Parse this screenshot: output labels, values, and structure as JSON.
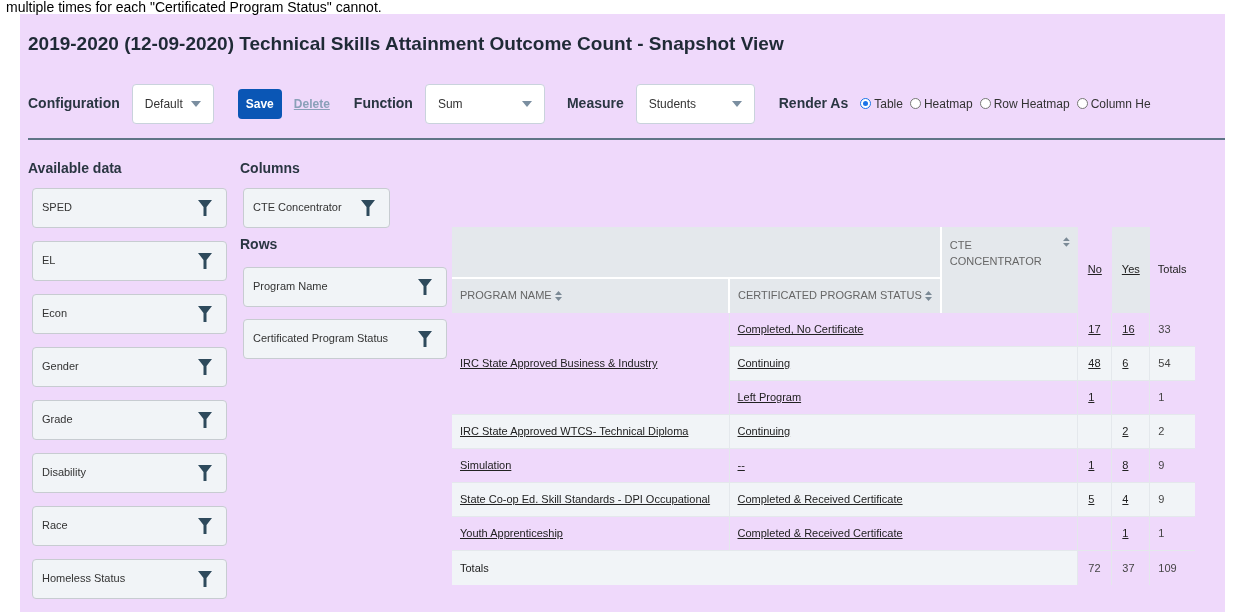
{
  "caption": "multiple times for each \"Certificated Program Status\" cannot.",
  "title": "2019-2020 (12-09-2020) Technical Skills Attainment Outcome Count - Snapshot View",
  "toolbar": {
    "configuration": {
      "label": "Configuration",
      "value": "Default"
    },
    "save": "Save",
    "delete": "Delete",
    "function": {
      "label": "Function",
      "value": "Sum"
    },
    "measure": {
      "label": "Measure",
      "value": "Students"
    },
    "render_as": {
      "label": "Render As",
      "options": [
        {
          "label": "Table",
          "selected": true
        },
        {
          "label": "Heatmap",
          "selected": false
        },
        {
          "label": "Row Heatmap",
          "selected": false
        },
        {
          "label": "Column He",
          "selected": false
        }
      ]
    }
  },
  "available_data": {
    "heading": "Available data",
    "items": [
      "SPED",
      "EL",
      "Econ",
      "Gender",
      "Grade",
      "Disability",
      "Race",
      "Homeless Status"
    ]
  },
  "columns": {
    "heading": "Columns",
    "items": [
      "CTE Concentrator"
    ]
  },
  "rows": {
    "heading": "Rows",
    "items": [
      "Program Name",
      "Certificated Program Status"
    ]
  },
  "table": {
    "column_field": "CTE CONCENTRATOR",
    "row_fields": [
      "PROGRAM NAME",
      "CERTIFICATED PROGRAM STATUS"
    ],
    "value_columns": [
      {
        "label": "No",
        "highlighted": false
      },
      {
        "label": "Yes",
        "highlighted": true
      }
    ],
    "totals_label": "Totals",
    "groups": [
      {
        "program": "IRC State Approved Business & Industry",
        "statuses": [
          {
            "status": "Completed, No Certificate",
            "no": "17",
            "yes": "16",
            "total": "33"
          },
          {
            "status": "Continuing",
            "no": "48",
            "yes": "6",
            "total": "54"
          },
          {
            "status": "Left Program",
            "no": "1",
            "total": "1"
          }
        ]
      },
      {
        "program": "IRC State Approved WTCS- Technical Diploma",
        "statuses": [
          {
            "status": "Continuing",
            "yes": "2",
            "total": "2"
          }
        ]
      },
      {
        "program": "Simulation",
        "statuses": [
          {
            "status": "--",
            "no": "1",
            "yes": "8",
            "total": "9"
          }
        ]
      },
      {
        "program": "State Co-op Ed. Skill Standards - DPI Occupational",
        "statuses": [
          {
            "status": "Completed & Received Certificate",
            "no": "5",
            "yes": "4",
            "total": "9"
          }
        ]
      },
      {
        "program": "Youth Apprenticeship",
        "statuses": [
          {
            "status": "Completed & Received Certificate",
            "yes": "1",
            "total": "1"
          }
        ]
      }
    ],
    "totals": {
      "label": "Totals",
      "no": "72",
      "yes": "37",
      "total": "109"
    }
  }
}
